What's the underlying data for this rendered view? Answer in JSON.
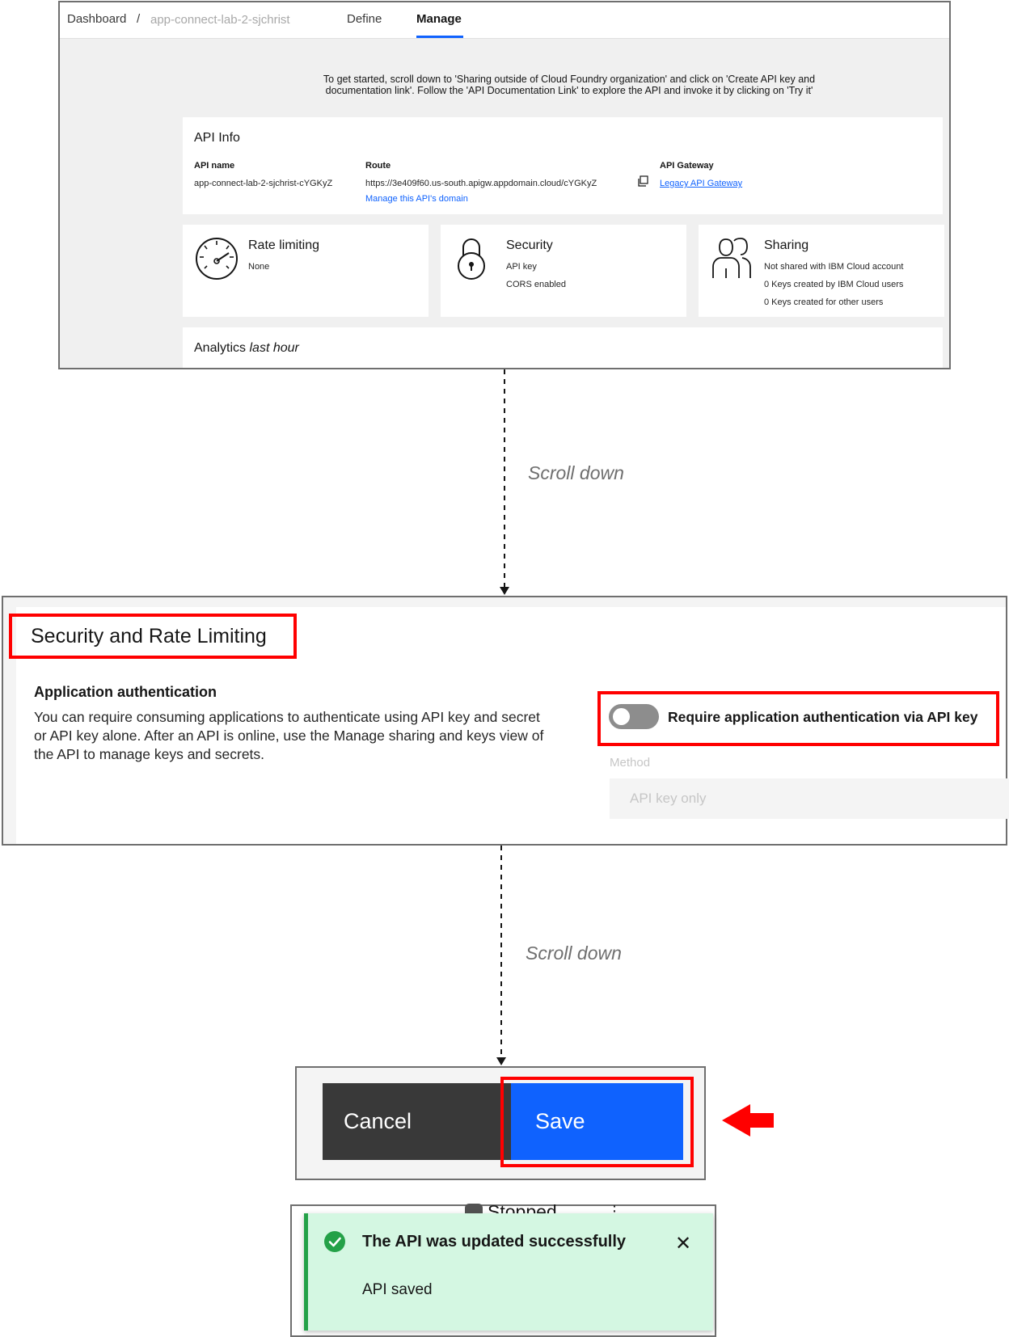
{
  "panel1": {
    "breadcrumb": {
      "dashboard": "Dashboard",
      "separator": "/",
      "app": "app-connect-lab-2-sjchrist"
    },
    "tabs": [
      "Define",
      "Manage"
    ],
    "active_tab": "Manage",
    "intro_line1": "To get started, scroll down to 'Sharing outside of Cloud Foundry organization' and click on 'Create API key and",
    "intro_line2": "documentation link'. Follow the 'API Documentation Link' to explore the API and invoke it by clicking on 'Try it'",
    "api_info": {
      "title": "API Info",
      "api_name_label": "API name",
      "api_name": "app-connect-lab-2-sjchrist-cYGKyZ",
      "route_label": "Route",
      "route": "https://3e409f60.us-south.apigw.appdomain.cloud/cYGKyZ",
      "manage_domain_link": "Manage this API's domain",
      "gateway_label": "API Gateway",
      "gateway_link": "Legacy API Gateway"
    },
    "rate_limiting": {
      "title": "Rate limiting",
      "value": "None",
      "icon": "gauge-icon"
    },
    "security": {
      "title": "Security",
      "line1": "API key",
      "line2": "CORS enabled",
      "icon": "lock-icon"
    },
    "sharing": {
      "title": "Sharing",
      "line1": "Not shared with IBM Cloud account",
      "line2": "0 Keys created by IBM Cloud users",
      "line3": "0 Keys created for other users",
      "icon": "users-icon"
    },
    "analytics": {
      "title": "Analytics",
      "qualifier": "last hour"
    }
  },
  "connector_labels": [
    "Scroll down",
    "Scroll down"
  ],
  "panel2": {
    "section_title": "Security and Rate Limiting",
    "app_auth_title": "Application authentication",
    "app_auth_line1": "You can require consuming applications to authenticate using API key and secret",
    "app_auth_line2": "or API key alone. After an API is online, use the Manage sharing and keys view of",
    "app_auth_line3": "the API to manage keys and secrets.",
    "toggle_label": "Require application authentication via API key",
    "toggle_state": "off",
    "method_label": "Method",
    "method_value": "API key only"
  },
  "panel3": {
    "cancel_label": "Cancel",
    "save_label": "Save"
  },
  "panel4": {
    "status_behind": "Stopped",
    "toast_title": "The API was updated successfully",
    "toast_subtitle": "API saved",
    "close_glyph": "✕"
  },
  "colors": {
    "highlight": "#ff0000",
    "primary": "#0f62fe",
    "cancel_bg": "#393939",
    "toast_bg": "#d4f7e2",
    "success": "#24a148"
  }
}
